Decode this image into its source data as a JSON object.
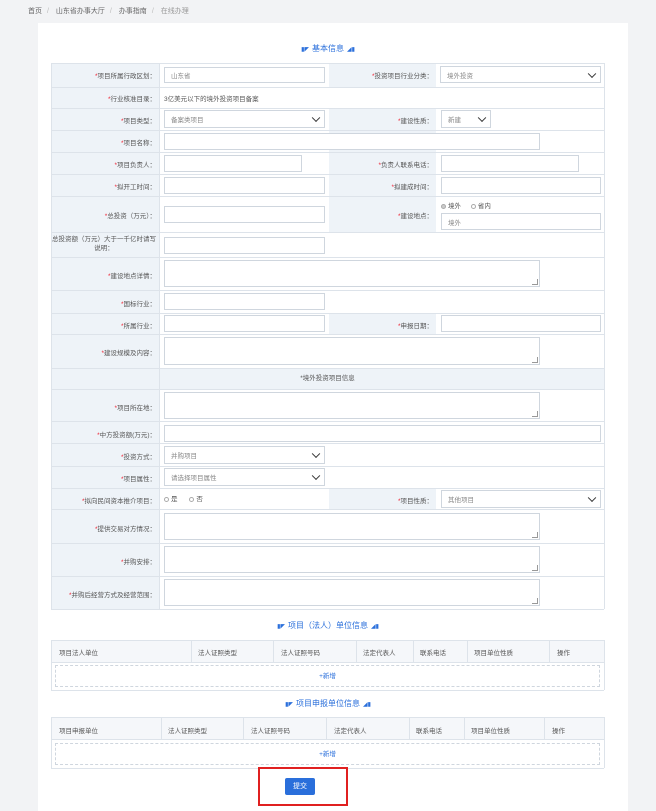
{
  "breadcrumb": {
    "items": [
      "首页",
      "山东省办事大厅",
      "办事指南"
    ],
    "current": "在线办理"
  },
  "sections": {
    "basic": "基本信息",
    "overseas": "*境外投资项目信息",
    "legal_unit": "项目（法人）单位信息",
    "apply_unit": "项目申报单位信息"
  },
  "fields": {
    "region": {
      "label": "项目所属行政区划：",
      "value": "山东省"
    },
    "industry_class": {
      "label": "投资项目行业分类：",
      "value": "境外投资"
    },
    "catalog": {
      "label": "行业核准目录：",
      "value": "3亿美元以下的境外投资项目备案"
    },
    "proj_type": {
      "label": "项目类型：",
      "value": "备案类项目"
    },
    "nature": {
      "label": "建设性质：",
      "value": "新建"
    },
    "proj_name": {
      "label": "项目名称："
    },
    "leader": {
      "label": "项目负责人："
    },
    "leader_phone": {
      "label": "负责人联系电话："
    },
    "start_time": {
      "label": "拟开工时间："
    },
    "end_time": {
      "label": "拟建成时间："
    },
    "total_inv": {
      "label": "总投资（万元）："
    },
    "location": {
      "label": "建设地点：",
      "opt1": "境外",
      "opt2": "省内",
      "value": "境外"
    },
    "over_note": {
      "label": "总投资额（万元）大于一千亿时请写说明："
    },
    "loc_detail": {
      "label": "建设地点详情："
    },
    "national_ind": {
      "label": "国标行业："
    },
    "ind": {
      "label": "所属行业："
    },
    "apply_date": {
      "label": "申报日期："
    },
    "scale": {
      "label": "建设规模及内容："
    },
    "project_loc": {
      "label": "项目所在地："
    },
    "cn_inv": {
      "label": "中方投资额(万元)："
    },
    "inv_mode": {
      "label": "投资方式：",
      "value": "并购项目"
    },
    "proj_attr": {
      "label": "项目属性：",
      "value": "请选择项目属性"
    },
    "private": {
      "label": "拟向民间资本推介项目：",
      "opt_yes": "是",
      "opt_no": "否"
    },
    "proj_nature": {
      "label": "项目性质：",
      "value": "其他项目"
    },
    "counterparty": {
      "label": "提供交易对方情况："
    },
    "merge_plan": {
      "label": "并购安排："
    },
    "post_merge": {
      "label": "并购后经营方式及经营范围："
    }
  },
  "legal_table": {
    "headers": [
      "项目法人单位",
      "法人证照类型",
      "法人证照号码",
      "法定代表人",
      "联系电话",
      "项目单位性质",
      "操作"
    ],
    "add": "+新增"
  },
  "apply_table": {
    "headers": [
      "项目申报单位",
      "法人证照类型",
      "法人证照号码",
      "法定代表人",
      "联系电话",
      "项目单位性质",
      "操作"
    ],
    "add": "+新增"
  },
  "submit_label": "提交"
}
